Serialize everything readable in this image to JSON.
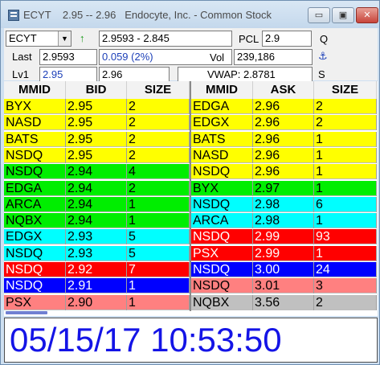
{
  "title": {
    "ticker": "ECYT",
    "range": "2.95 -- 2.96",
    "company": "Endocyte, Inc. - Common Stock"
  },
  "window_buttons": {
    "minimize": "▭",
    "maximize": "▣",
    "close": "✕"
  },
  "toolbar": {
    "symbol": "ECYT",
    "trend_arrow": "↑",
    "day_range": "2.9593 - 2.845",
    "pcl_label": "PCL",
    "pcl_value": "2.9",
    "q_label": "Q",
    "last_label": "Last",
    "last_value": "2.9593",
    "change_value": "0.059  (2%)",
    "vol_label": "Vol",
    "vol_value": "239,186",
    "anchor_glyph": "⚓",
    "lv1_label": "Lv1",
    "lv1_bid": "2.95",
    "lv1_ask": "2.96",
    "vwap": "VWAP: 2.8781",
    "s_label": "S"
  },
  "bid_columns": [
    "MMID",
    "BID",
    "SIZE"
  ],
  "ask_columns": [
    "MMID",
    "ASK",
    "SIZE"
  ],
  "bids": [
    {
      "mmid": "BYX",
      "price": "2.95",
      "size": "2",
      "bg": "#ffff00",
      "fg": "#000000"
    },
    {
      "mmid": "NASD",
      "price": "2.95",
      "size": "2",
      "bg": "#ffff00",
      "fg": "#000000"
    },
    {
      "mmid": "BATS",
      "price": "2.95",
      "size": "2",
      "bg": "#ffff00",
      "fg": "#000000"
    },
    {
      "mmid": "NSDQ",
      "price": "2.95",
      "size": "2",
      "bg": "#ffff00",
      "fg": "#000000"
    },
    {
      "mmid": "NSDQ",
      "price": "2.94",
      "size": "4",
      "bg": "#00ee00",
      "fg": "#000000"
    },
    {
      "mmid": "EDGA",
      "price": "2.94",
      "size": "2",
      "bg": "#00ee00",
      "fg": "#000000"
    },
    {
      "mmid": "ARCA",
      "price": "2.94",
      "size": "1",
      "bg": "#00ee00",
      "fg": "#000000"
    },
    {
      "mmid": "NQBX",
      "price": "2.94",
      "size": "1",
      "bg": "#00ee00",
      "fg": "#000000"
    },
    {
      "mmid": "EDGX",
      "price": "2.93",
      "size": "5",
      "bg": "#00ffff",
      "fg": "#000000"
    },
    {
      "mmid": "NSDQ",
      "price": "2.93",
      "size": "5",
      "bg": "#00ffff",
      "fg": "#000000"
    },
    {
      "mmid": "NSDQ",
      "price": "2.92",
      "size": "7",
      "bg": "#ff0000",
      "fg": "#ffffff"
    },
    {
      "mmid": "NSDQ",
      "price": "2.91",
      "size": "1",
      "bg": "#0000ff",
      "fg": "#ffffff"
    },
    {
      "mmid": "PSX",
      "price": "2.90",
      "size": "1",
      "bg": "#ff8080",
      "fg": "#000000"
    }
  ],
  "asks": [
    {
      "mmid": "EDGA",
      "price": "2.96",
      "size": "2",
      "bg": "#ffff00",
      "fg": "#000000"
    },
    {
      "mmid": "EDGX",
      "price": "2.96",
      "size": "2",
      "bg": "#ffff00",
      "fg": "#000000"
    },
    {
      "mmid": "BATS",
      "price": "2.96",
      "size": "1",
      "bg": "#ffff00",
      "fg": "#000000"
    },
    {
      "mmid": "NASD",
      "price": "2.96",
      "size": "1",
      "bg": "#ffff00",
      "fg": "#000000"
    },
    {
      "mmid": "NSDQ",
      "price": "2.96",
      "size": "1",
      "bg": "#ffff00",
      "fg": "#000000"
    },
    {
      "mmid": "BYX",
      "price": "2.97",
      "size": "1",
      "bg": "#00ee00",
      "fg": "#000000"
    },
    {
      "mmid": "NSDQ",
      "price": "2.98",
      "size": "6",
      "bg": "#00ffff",
      "fg": "#000000"
    },
    {
      "mmid": "ARCA",
      "price": "2.98",
      "size": "1",
      "bg": "#00ffff",
      "fg": "#000000"
    },
    {
      "mmid": "NSDQ",
      "price": "2.99",
      "size": "93",
      "bg": "#ff0000",
      "fg": "#ffffff"
    },
    {
      "mmid": "PSX",
      "price": "2.99",
      "size": "1",
      "bg": "#ff0000",
      "fg": "#ffffff"
    },
    {
      "mmid": "NSDQ",
      "price": "3.00",
      "size": "24",
      "bg": "#0000ff",
      "fg": "#ffffff"
    },
    {
      "mmid": "NSDQ",
      "price": "3.01",
      "size": "3",
      "bg": "#ff8080",
      "fg": "#000000"
    },
    {
      "mmid": "NQBX",
      "price": "3.56",
      "size": "2",
      "bg": "#c0c0c0",
      "fg": "#000000"
    }
  ],
  "clock": "05/15/17  10:53:50"
}
